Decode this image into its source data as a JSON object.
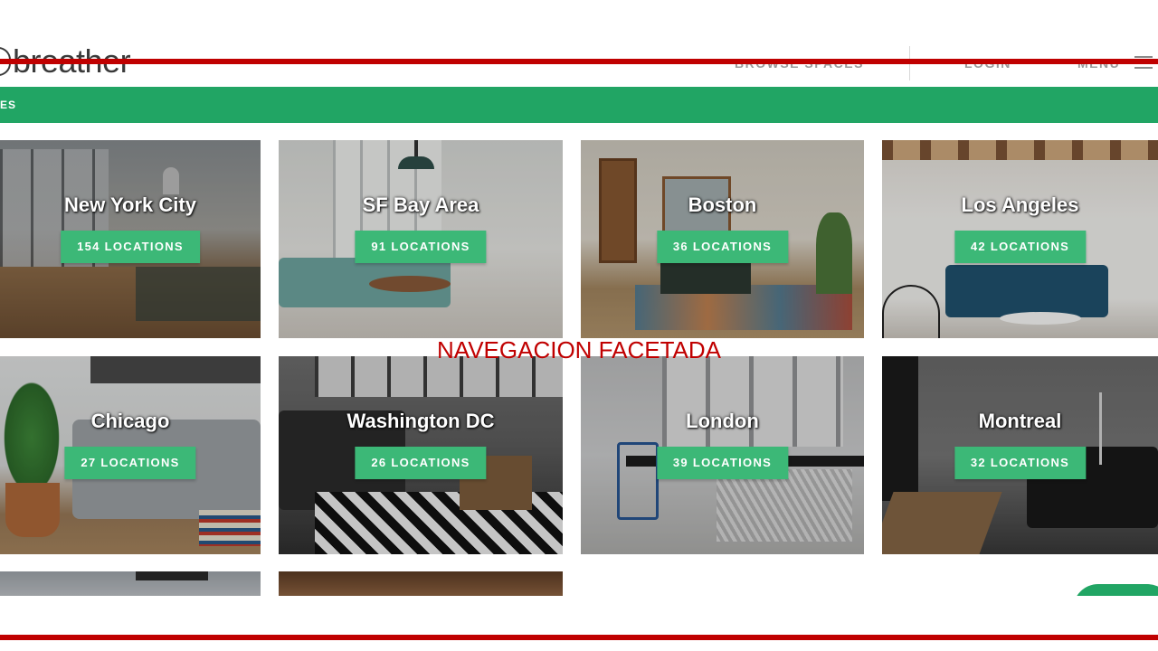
{
  "header": {
    "logo_text": "breather",
    "nav": {
      "browse": "BROWSE SPACES",
      "login": "LOGIN",
      "menu": "MENU"
    }
  },
  "green_bar": {
    "label": "ES"
  },
  "overlay": {
    "title": "NAVEGACION FACETADA"
  },
  "colors": {
    "brand_green": "#21a564",
    "button_green": "#3cb877",
    "annotation_red": "#c00000"
  },
  "cities": [
    {
      "name": "New York City",
      "locations": "154 LOCATIONS"
    },
    {
      "name": "SF Bay Area",
      "locations": "91 LOCATIONS"
    },
    {
      "name": "Boston",
      "locations": "36 LOCATIONS"
    },
    {
      "name": "Los Angeles",
      "locations": "42 LOCATIONS"
    },
    {
      "name": "Chicago",
      "locations": "27 LOCATIONS"
    },
    {
      "name": "Washington DC",
      "locations": "26 LOCATIONS"
    },
    {
      "name": "London",
      "locations": "39 LOCATIONS"
    },
    {
      "name": "Montreal",
      "locations": "32 LOCATIONS"
    }
  ]
}
